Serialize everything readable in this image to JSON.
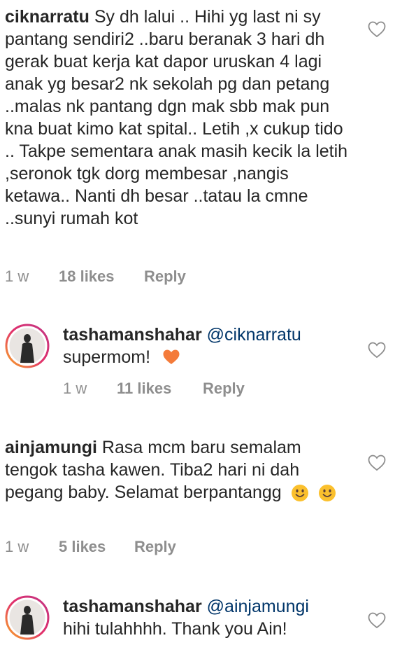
{
  "comments": [
    {
      "username": "ciknarratu",
      "text": "Sy dh lalui .. Hihi yg last ni sy pantang sendiri2 ..baru beranak 3 hari dh gerak buat kerja kat dapor uruskan 4 lagi anak yg besar2 nk sekolah pg dan petang ..malas nk pantang dgn mak sbb mak pun kna buat kimo kat spital.. Letih ,x cukup tido .. Takpe sementara anak masih kecik la letih ,seronok tgk dorg membesar ,nangis ketawa.. Nanti dh besar ..tatau la cmne ..sunyi rumah kot",
      "age": "1 w",
      "likes": "18 likes",
      "reply": "Reply"
    },
    {
      "username": "tashamanshahar",
      "mention": "@ciknarratu",
      "text": "supermom!",
      "emoji": "orange-heart",
      "age": "1 w",
      "likes": "11 likes",
      "reply": "Reply"
    },
    {
      "username": "ainjamungi",
      "text": "Rasa mcm baru semalam tengok tasha kawen. Tiba2 hari ni dah pegang baby. Selamat berpantangg",
      "emoji": "smiley",
      "age": "1 w",
      "likes": "5 likes",
      "reply": "Reply"
    },
    {
      "username": "tashamanshahar",
      "mention": "@ainjamungi",
      "text": "hihi tulahhhh. Thank you Ain!"
    }
  ],
  "colors": {
    "text": "#262626",
    "meta": "#8e8e8e",
    "mention": "#003569",
    "heart_emoji": "#f47b3a",
    "story_ring_start": "#f9a825",
    "story_ring_end": "#c13584"
  }
}
